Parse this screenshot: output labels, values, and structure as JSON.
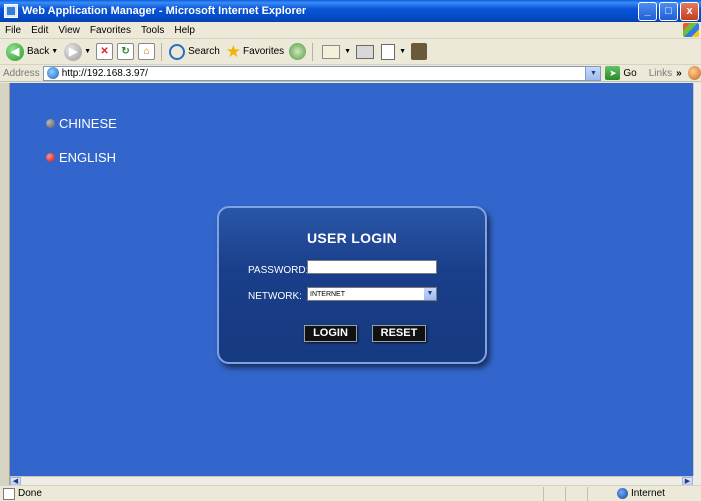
{
  "window": {
    "title": "Web Application Manager - Microsoft Internet Explorer",
    "buttons": [
      "_",
      "□",
      "x"
    ]
  },
  "menu": [
    "File",
    "Edit",
    "View",
    "Favorites",
    "Tools",
    "Help"
  ],
  "toolbar": {
    "back_label": "Back",
    "search_label": "Search",
    "favorites_label": "Favorites"
  },
  "address": {
    "label": "Address",
    "url": "http://192.168.3.97/",
    "go_label": "Go",
    "links_label": "Links"
  },
  "page": {
    "languages": [
      {
        "label": "CHINESE",
        "selected": false
      },
      {
        "label": "ENGLISH",
        "selected": true
      }
    ],
    "login": {
      "title": "USER LOGIN",
      "password_label": "PASSWORD:",
      "password_value": "",
      "network_label": "NETWORK:",
      "network_value": "INTERNET",
      "login_button": "LOGIN",
      "reset_button": "RESET"
    },
    "colors": {
      "background": "#3366cc",
      "panel": "#1a3f8a",
      "selected_language_dot": "#c41212"
    }
  },
  "status": {
    "text": "Done",
    "zone": "Internet"
  }
}
